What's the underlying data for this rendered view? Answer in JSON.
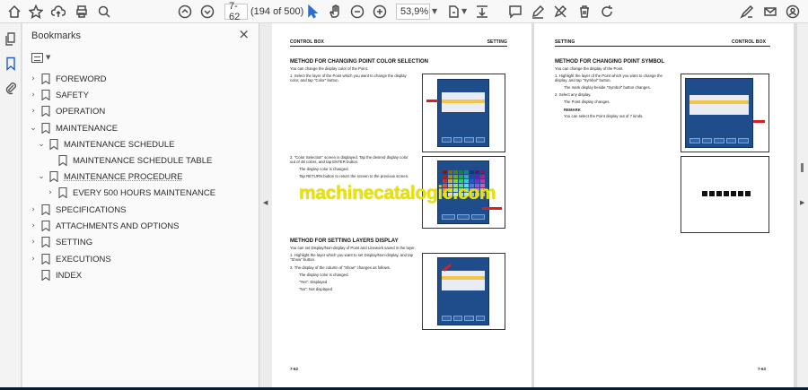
{
  "toolbar": {
    "page_input": "7-62",
    "page_count": "(194 of 500)",
    "zoom": "53,9%"
  },
  "bookmarks": {
    "title": "Bookmarks",
    "close": "×",
    "items": [
      {
        "label": "FOREWORD",
        "expanded": false
      },
      {
        "label": "SAFETY",
        "expanded": false
      },
      {
        "label": "OPERATION",
        "expanded": false
      },
      {
        "label": "MAINTENANCE",
        "expanded": true
      },
      {
        "label": "MAINTENANCE SCHEDULE",
        "expanded": true
      },
      {
        "label": "MAINTENANCE SCHEDULE TABLE",
        "expanded": null
      },
      {
        "label": "MAINTENANCE PROCEDURE",
        "expanded": true
      },
      {
        "label": "EVERY 500 HOURS MAINTENANCE",
        "expanded": false
      },
      {
        "label": "SPECIFICATIONS",
        "expanded": false
      },
      {
        "label": "ATTACHMENTS AND OPTIONS",
        "expanded": false
      },
      {
        "label": "SETTING",
        "expanded": false
      },
      {
        "label": "EXECUTIONS",
        "expanded": false
      },
      {
        "label": "INDEX",
        "expanded": null
      }
    ]
  },
  "page_left": {
    "header_left": "CONTROL BOX",
    "header_right": "SETTING",
    "sec1_title": "METHOD FOR CHANGING POINT COLOR SELECTION",
    "sec1_intro": "You can change the display color of the Point.",
    "step1": "1.    Select the layer of the Point which you want to change the display color, and tap \"Color\" button.",
    "step2": "2.    \"Color Selection\" screen is displayed. Tap the desired display color out of 48 colors, and tap ENTER button.",
    "step2b": "The display color is changed.",
    "step2c": "Tap RETURN button to return the screen to the previous screen.",
    "sec2_title": "METHOD FOR SETTING LAYERS DISPLAY",
    "sec2_intro": "You can set Display/Non-display of Point and Linework saved in the layer.",
    "s2_step1": "1.    Highlight the layer which you want to set Display/Non-display, and tap \"Show\" button.",
    "s2_step2": "2.    The display of the column of \"Show\" changes as follows.",
    "s2_step2b": "The display color is changed.",
    "s2_yes": "\"Yes\": Displayed",
    "s2_no": "\"No\": Not displayed",
    "page_number": "7-62"
  },
  "page_right": {
    "header_left": "SETTING",
    "header_right": "CONTROL BOX",
    "sec_title": "METHOD FOR CHANGING POINT SYMBOL",
    "intro": "You can change the display of the Point.",
    "step1": "1.    Highlight the layer of the Point which you want to change the display, and tap \"Symbol\" button.",
    "step1b": "The mark display beside \"Symbol\" button changes.",
    "step2": "2.    Select any display.",
    "step2b": "The Point display changes.",
    "remark_title": "REMARK",
    "remark": "You can select the Point display out of 7 kinds.",
    "page_number": "7-63"
  },
  "watermark": "machinecatalogic.com",
  "colors": {
    "screen_blue": "#1f4c8a",
    "highlight": "#f2c447",
    "arrow_red": "#d81f26",
    "watermark": "#e8e300"
  }
}
